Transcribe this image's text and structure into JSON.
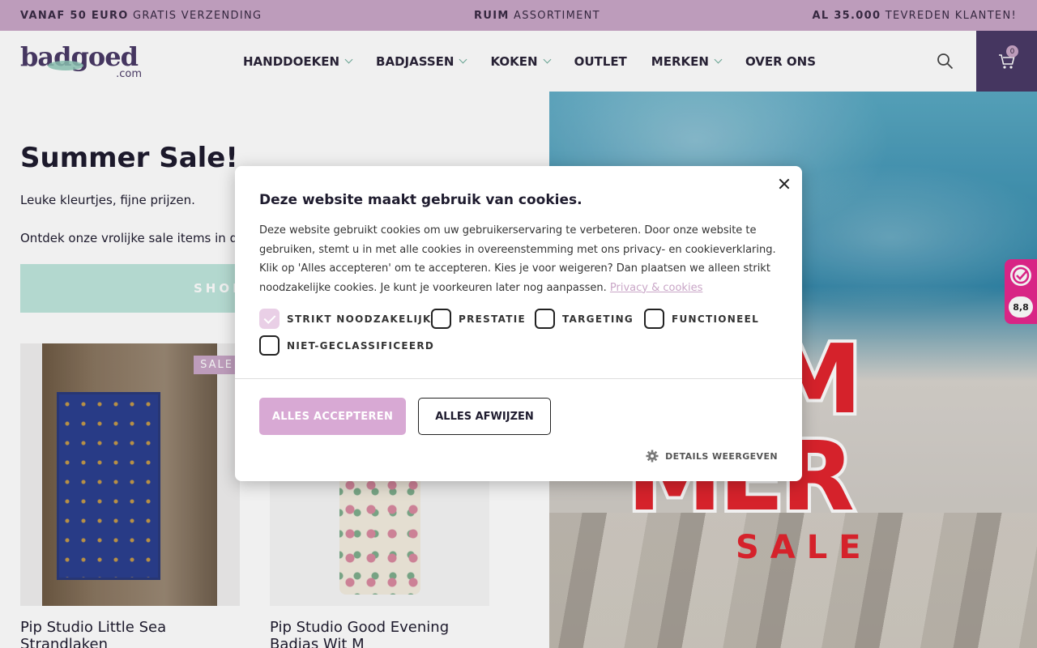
{
  "promo": {
    "left_bold": "VANAF 50 EURO",
    "left_rest": " GRATIS VERZENDING",
    "center_bold": "RUIM",
    "center_rest": " ASSORTIMENT",
    "right_bold": "AL 35.000",
    "right_rest": " TEVREDEN KLANTEN!"
  },
  "header": {
    "logo_word": "badgoed",
    "logo_suffix": ".com",
    "nav": [
      {
        "label": "HANDDOEKEN",
        "has_dropdown": true
      },
      {
        "label": "BADJASSEN",
        "has_dropdown": true
      },
      {
        "label": "KOKEN",
        "has_dropdown": true
      },
      {
        "label": "OUTLET",
        "has_dropdown": false
      },
      {
        "label": "MERKEN",
        "has_dropdown": true
      },
      {
        "label": "OVER ONS",
        "has_dropdown": false
      }
    ],
    "search_icon": "search-icon",
    "cart_icon": "cart-icon",
    "cart_count": "0"
  },
  "hero": {
    "title": "Summer Sale!",
    "subtitle": "Leuke kleurtjes, fijne prijzen.",
    "subtitle2": "Ontdek onze vrolijke sale items in de",
    "shop_button": "SHOP"
  },
  "products": [
    {
      "title": "Pip Studio Little Sea Strandlaken",
      "badge": "SALE"
    },
    {
      "title": "Pip Studio Good Evening Badjas Wit M",
      "badge": ""
    }
  ],
  "banner": {
    "line1": "SUM",
    "line2": "MER",
    "line3": "SALE"
  },
  "rating_widget": {
    "score": "8,8"
  },
  "cookie_modal": {
    "title": "Deze website maakt gebruik van cookies.",
    "body": "Deze website gebruikt cookies om uw gebruikerservaring te verbeteren. Door onze website te gebruiken, stemt u in met alle cookies in overeenstemming met ons privacy- en cookieverklaring. Klik op 'Alles accepteren' om te accepteren. Kies je voor weigeren? Dan plaatsen we alleen strikt noodzakelijke cookies. Je kunt je voorkeuren later nog aanpassen. ",
    "link": "Privacy & cookies",
    "checkboxes": [
      {
        "label": "STRIKT NOODZAKELIJK",
        "checked": true
      },
      {
        "label": "PRESTATIE",
        "checked": false
      },
      {
        "label": "TARGETING",
        "checked": false
      },
      {
        "label": "FUNCTIONEEL",
        "checked": false
      },
      {
        "label": "NIET-GECLASSIFICEERD",
        "checked": false
      }
    ],
    "accept_button": "ALLES ACCEPTEREN",
    "reject_button": "ALLES AFWIJZEN",
    "details_link": "DETAILS WEERGEVEN"
  },
  "colors": {
    "promo_bg": "#c9a6c7",
    "brand_purple": "#4a3a66",
    "mint": "#bfe6dc",
    "accept_pink": "#d8a9d4",
    "banner_red": "#e3252e"
  }
}
